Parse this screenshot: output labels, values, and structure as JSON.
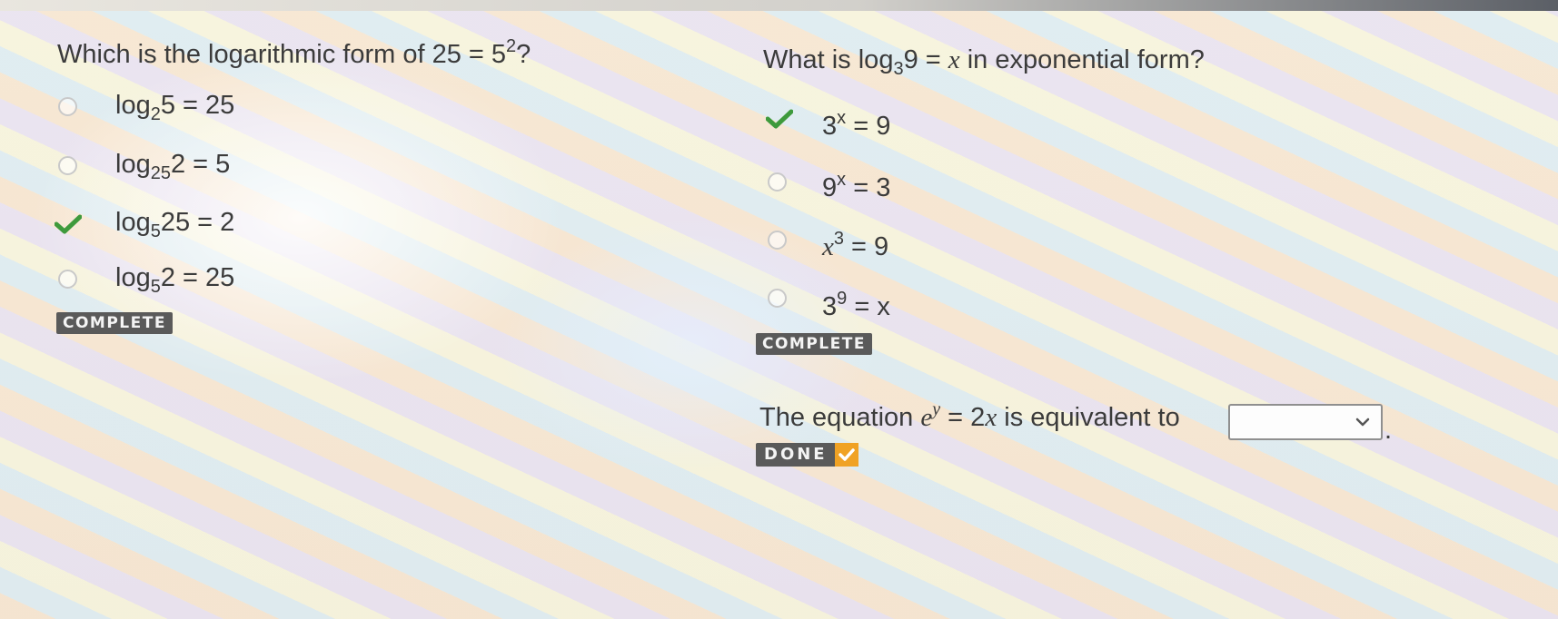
{
  "question1": {
    "prefix": "Which is the logarithmic form of 25 = 5",
    "sup": "2",
    "suffix": "?",
    "options": [
      {
        "log": "log",
        "base": "2",
        "rest": "5 = 25",
        "state": "radio"
      },
      {
        "log": "log",
        "base": "25",
        "rest": "2 = 5",
        "state": "radio"
      },
      {
        "log": "log",
        "base": "5",
        "rest": "25 = 2",
        "state": "checked"
      },
      {
        "log": "log",
        "base": "5",
        "rest": "2 = 25",
        "state": "radio"
      }
    ],
    "badge": "COMPLETE"
  },
  "question2": {
    "prefix": "What is log",
    "base": "3",
    "middle": "9 = ",
    "var": "x",
    "suffix": " in exponential form?",
    "options": [
      {
        "base": "3",
        "exp": "x",
        "rest": " = 9",
        "state": "checked"
      },
      {
        "base": "9",
        "exp": "x",
        "rest": " = 3",
        "state": "radio"
      },
      {
        "base": "x",
        "exp": "3",
        "rest": " = 9",
        "state": "radio"
      },
      {
        "base": "3",
        "exp": "9",
        "rest": " = x",
        "state": "radio"
      }
    ],
    "badge": "COMPLETE"
  },
  "question3": {
    "prefix": "The equation ",
    "e": "e",
    "exp": "y",
    "middle": " = 2",
    "var": "x",
    "suffix": " is equivalent to",
    "dropdown_value": "",
    "period": ".",
    "done_label": "DONE"
  },
  "colors": {
    "check_green": "#3e9a3c",
    "badge_gray": "#5a5a5a",
    "done_tick_orange": "#f0a224"
  },
  "icons": {
    "correct": "checkmark-icon",
    "dropdown": "chevron-down-icon"
  }
}
